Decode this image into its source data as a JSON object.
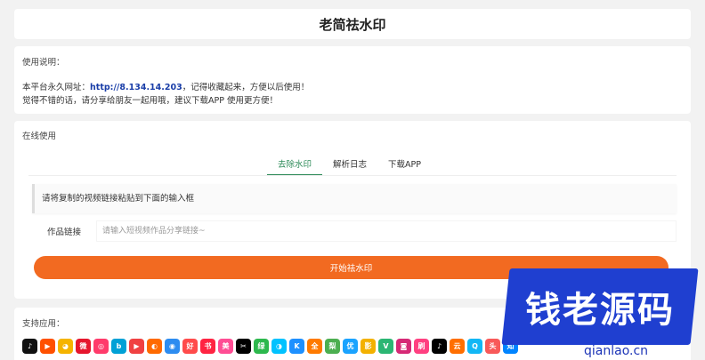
{
  "header": {
    "title": "老简祛水印"
  },
  "info": {
    "label": "使用说明：",
    "line1_prefix": "本平台永久网址：",
    "line1_url": "http://8.134.14.203",
    "line1_suffix": "，记得收藏起来，方便以后使用！",
    "line2": "觉得不错的话，请分享给朋友一起用哦，建议下载APP 使用更方便！"
  },
  "online": {
    "label": "在线使用",
    "tabs": [
      {
        "label": "去除水印",
        "active": true
      },
      {
        "label": "解析日志",
        "active": false
      },
      {
        "label": "下载APP",
        "active": false
      }
    ],
    "notice": "请将复制的视频链接粘贴到下面的输入框",
    "field_label": "作品链接",
    "field_placeholder": "请输入短视频作品分享链接~",
    "submit_label": "开始祛水印"
  },
  "apps": {
    "label": "支持应用：",
    "icons": [
      {
        "name": "douyin-icon",
        "color": "#111111",
        "glyph": "♪"
      },
      {
        "name": "kuaishou-icon",
        "color": "#ff5000",
        "glyph": "▶"
      },
      {
        "name": "pipixia-icon",
        "color": "#f5b400",
        "glyph": "◕"
      },
      {
        "name": "weibo-icon",
        "color": "#e6162d",
        "glyph": "微"
      },
      {
        "name": "weishi-icon",
        "color": "#ff3b6b",
        "glyph": "◎"
      },
      {
        "name": "bilibili-icon",
        "color": "#00a1d6",
        "glyph": "b"
      },
      {
        "name": "xigua-icon",
        "color": "#f04142",
        "glyph": "▶"
      },
      {
        "name": "huoshan-icon",
        "color": "#ff6a00",
        "glyph": "◐"
      },
      {
        "name": "zuiyou-icon",
        "color": "#2d8cf0",
        "glyph": "◉"
      },
      {
        "name": "haokan-icon",
        "color": "#ff4b4b",
        "glyph": "好"
      },
      {
        "name": "xiaohongshu-icon",
        "color": "#ff2442",
        "glyph": "书"
      },
      {
        "name": "meipai-icon",
        "color": "#ff4d94",
        "glyph": "美"
      },
      {
        "name": "capcut-icon",
        "color": "#000000",
        "glyph": "✂"
      },
      {
        "name": "lvzhou-icon",
        "color": "#2db84d",
        "glyph": "绿"
      },
      {
        "name": "momo-icon",
        "color": "#00c2ff",
        "glyph": "◑"
      },
      {
        "name": "kg-icon",
        "color": "#1e90ff",
        "glyph": "K"
      },
      {
        "name": "quanmin-icon",
        "color": "#ff7a00",
        "glyph": "全"
      },
      {
        "name": "pear-icon",
        "color": "#4caf50",
        "glyph": "梨"
      },
      {
        "name": "youku-icon",
        "color": "#1aa3ff",
        "glyph": "优"
      },
      {
        "name": "xiaoying-icon",
        "color": "#f3b100",
        "glyph": "影"
      },
      {
        "name": "vue-icon",
        "color": "#2bb673",
        "glyph": "V"
      },
      {
        "name": "instagram-icon",
        "color": "#d62976",
        "glyph": "◙"
      },
      {
        "name": "shuabao-icon",
        "color": "#ff4081",
        "glyph": "刷"
      },
      {
        "name": "tiktok-icon",
        "color": "#010101",
        "glyph": "♪"
      },
      {
        "name": "weiyun-icon",
        "color": "#ff6f00",
        "glyph": "云"
      },
      {
        "name": "qq-icon",
        "color": "#12b7f5",
        "glyph": "Q"
      },
      {
        "name": "toutiao-icon",
        "color": "#f85959",
        "glyph": "头"
      },
      {
        "name": "zhihu-icon",
        "color": "#0084ff",
        "glyph": "知"
      }
    ]
  },
  "watermark": {
    "text": "钱老源码",
    "site": "qianlao.cn"
  }
}
